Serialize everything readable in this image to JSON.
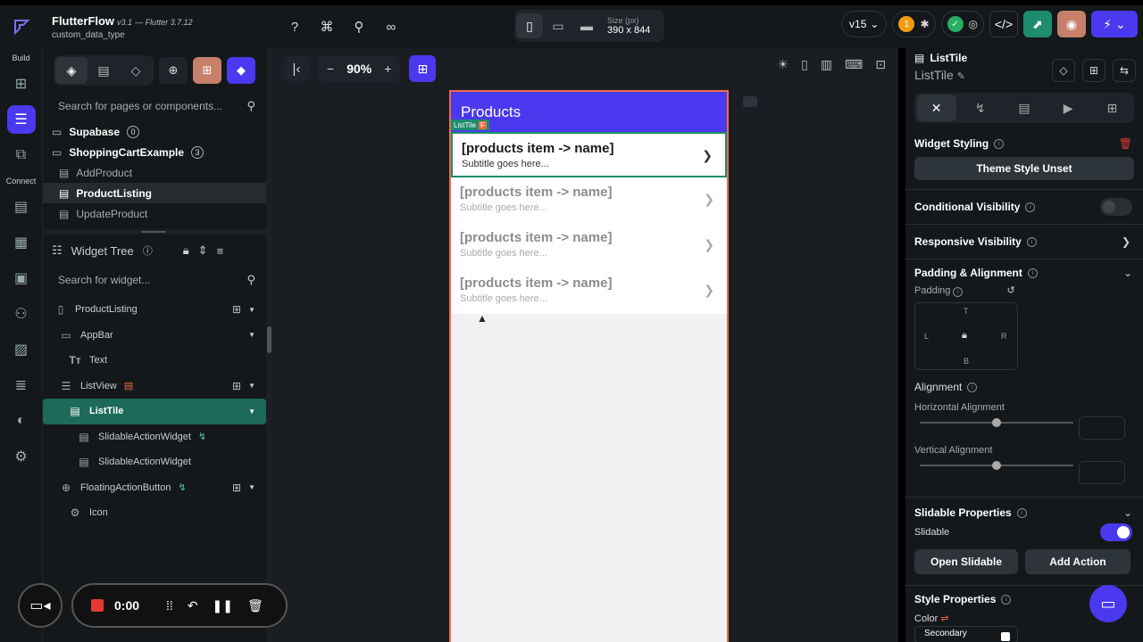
{
  "app": {
    "name": "FlutterFlow",
    "version": "v3.1",
    "flutter": "— Flutter 3.7.12",
    "project": "custom_data_type"
  },
  "topbar": {
    "size_label": "Size (px)",
    "size_value": "390 x 844",
    "version_selector": "v15",
    "notif_count": "1"
  },
  "rail": {
    "build_label": "Build",
    "connect_label": "Connect"
  },
  "left_panel": {
    "search_placeholder": "Search for pages or components...",
    "folders": [
      {
        "label": "Supabase",
        "count": "0"
      },
      {
        "label": "ShoppingCartExample",
        "count": "3"
      }
    ],
    "pages": [
      "AddProduct",
      "ProductListing",
      "UpdateProduct"
    ],
    "widget_tree_title": "Widget Tree",
    "widget_search_placeholder": "Search for widget...",
    "tree": [
      {
        "label": "ProductListing"
      },
      {
        "label": "AppBar"
      },
      {
        "label": "Text"
      },
      {
        "label": "ListView"
      },
      {
        "label": "ListTile"
      },
      {
        "label": "SlidableActionWidget"
      },
      {
        "label": "SlidableActionWidget"
      },
      {
        "label": "FloatingActionButton"
      },
      {
        "label": "Icon"
      }
    ]
  },
  "canvas": {
    "zoom": "90%",
    "appbar_title": "Products",
    "selected_tag": "ListTile",
    "items": [
      {
        "title": "[products item -> name]",
        "subtitle": "Subtitle goes here..."
      },
      {
        "title": "[products item -> name]",
        "subtitle": "Subtitle goes here..."
      },
      {
        "title": "[products item -> name]",
        "subtitle": "Subtitle goes here..."
      },
      {
        "title": "[products item -> name]",
        "subtitle": "Subtitle goes here..."
      }
    ]
  },
  "right_panel": {
    "widget_type": "ListTile",
    "widget_name": "ListTile",
    "widget_styling": "Widget Styling",
    "theme_style": "Theme Style Unset",
    "conditional_visibility": "Conditional Visibility",
    "responsive_visibility": "Responsive Visibility",
    "padding_alignment": "Padding & Alignment",
    "padding_label": "Padding",
    "pad_t": "T",
    "pad_l": "L",
    "pad_r": "R",
    "pad_b": "B",
    "alignment_label": "Alignment",
    "horizontal_alignment": "Horizontal Alignment",
    "vertical_alignment": "Vertical Alignment",
    "slidable_properties": "Slidable Properties",
    "slidable_label": "Slidable",
    "open_slidable": "Open Slidable",
    "add_action": "Add Action",
    "style_properties": "Style Properties",
    "color_label": "Color",
    "color_value": "Secondary"
  },
  "recorder": {
    "time": "0:00"
  },
  "colors": {
    "primary": "#4b39ef",
    "selected_tree": "#1e6a5a",
    "tile_border": "#1e8c6e",
    "phone_border": "#ef6b4a"
  }
}
